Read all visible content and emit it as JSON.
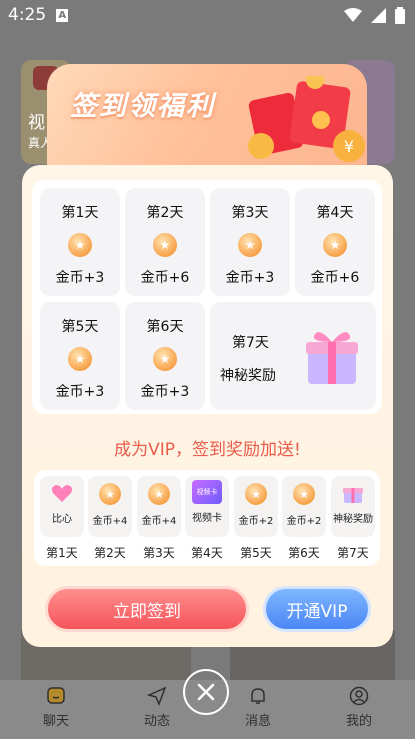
{
  "status_bar": {
    "time": "4:25",
    "notification_letter": "A"
  },
  "background": {
    "left_card_text_1": "视",
    "left_card_text_2": "真人",
    "tabs": [
      {
        "label": "聊天",
        "icon": "chat-icon"
      },
      {
        "label": "动态",
        "icon": "send-icon"
      },
      {
        "label": "消息",
        "icon": "bell-icon"
      },
      {
        "label": "我的",
        "icon": "profile-icon"
      }
    ]
  },
  "popup": {
    "title": "签到领福利",
    "days": [
      {
        "label": "第1天",
        "reward": "金币+3"
      },
      {
        "label": "第2天",
        "reward": "金币+6"
      },
      {
        "label": "第3天",
        "reward": "金币+3"
      },
      {
        "label": "第4天",
        "reward": "金币+6"
      },
      {
        "label": "第5天",
        "reward": "金币+3"
      },
      {
        "label": "第6天",
        "reward": "金币+3"
      },
      {
        "label": "第7天",
        "reward": "神秘奖励"
      }
    ],
    "vip_banner": "成为VIP，签到奖励加送!",
    "vip_rewards": [
      {
        "reward": "比心",
        "day": "第1天",
        "icon": "heart-hand-icon"
      },
      {
        "reward": "金币+4",
        "day": "第2天",
        "icon": "coin-icon"
      },
      {
        "reward": "金币+4",
        "day": "第3天",
        "icon": "coin-icon"
      },
      {
        "reward": "视频卡",
        "day": "第4天",
        "icon": "video-card-icon",
        "card_text": "视频卡"
      },
      {
        "reward": "金币+2",
        "day": "第5天",
        "icon": "coin-icon"
      },
      {
        "reward": "金币+2",
        "day": "第6天",
        "icon": "coin-icon"
      },
      {
        "reward": "神秘奖励",
        "day": "第7天",
        "icon": "gift-icon"
      }
    ],
    "sign_button": "立即签到",
    "vip_button": "开通VIP"
  },
  "colors": {
    "accent_red": "#f5545a",
    "accent_blue": "#4b86f5",
    "coin": "#f7a24a",
    "vip_text": "#e95c4c"
  }
}
